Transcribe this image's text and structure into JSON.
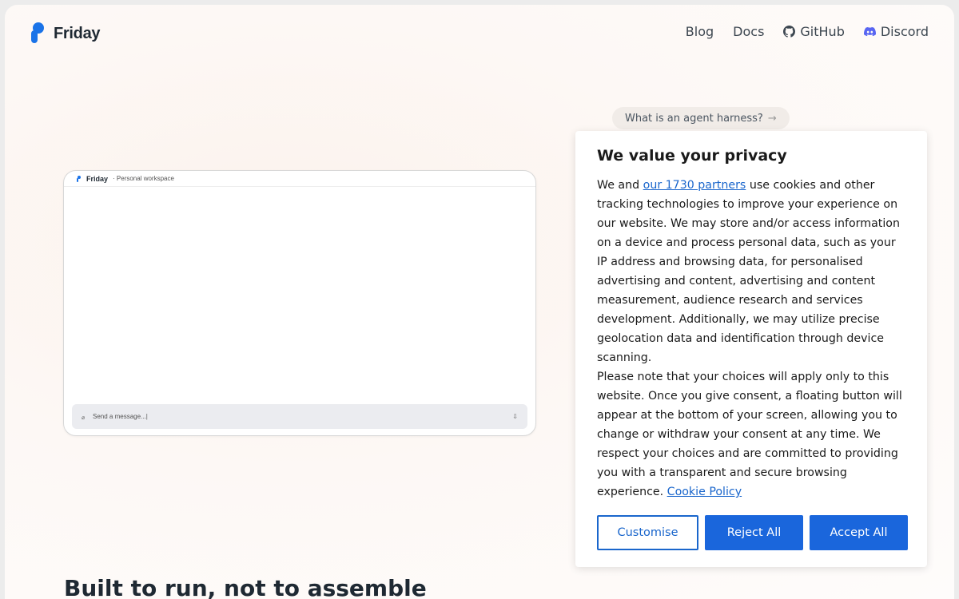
{
  "brand": {
    "name": "Friday"
  },
  "nav": {
    "blog": "Blog",
    "docs": "Docs",
    "github": "GitHub",
    "discord": "Discord"
  },
  "pill": {
    "label": "What is an agent harness?",
    "arrow": "→"
  },
  "preview": {
    "title": "Friday",
    "subtitle": "· Personal workspace",
    "composer_placeholder": "Send a message...|"
  },
  "section": {
    "heading": "Built to run, not to assemble"
  },
  "consent": {
    "title": "We value your privacy",
    "p1_before": "We and ",
    "partners_link": "our 1730 partners",
    "p1_after": " use cookies and other tracking technologies to improve your experience on our website. We may store and/or access information on a device and process personal data, such as your IP address and browsing data, for personalised advertising and content, advertising and content measurement, audience research and services development. Additionally, we may utilize precise geolocation data and identification through device scanning.",
    "p2": "Please note that your choices will apply only to this website. Once you give consent, a floating button will appear at the bottom of your screen, allowing you to change or withdraw your consent at any time. We respect your choices and are committed to providing you with a transparent and secure browsing experience. ",
    "cookie_policy_link": "Cookie Policy",
    "customise_label": "Customise",
    "reject_label": "Reject All",
    "accept_label": "Accept All"
  },
  "colors": {
    "accent": "#1a66dc",
    "brand": "#1a73e8"
  }
}
